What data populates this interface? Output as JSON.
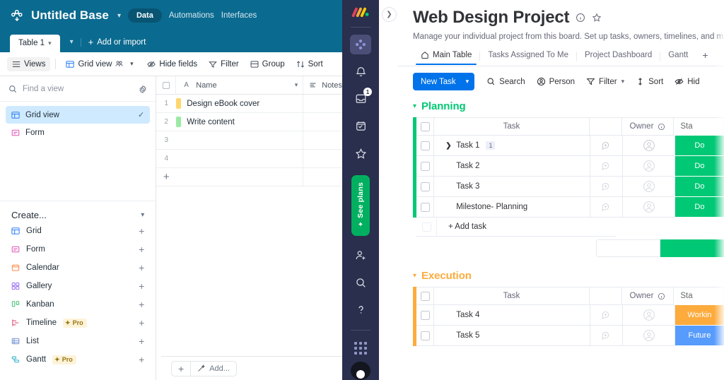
{
  "airtable": {
    "topbar": {
      "logo_icon": "airtable-logo-icon",
      "base_name": "Untitled Base",
      "base_caret_icon": "chevron-down-icon",
      "nav": [
        {
          "label": "Data",
          "active": true
        },
        {
          "label": "Automations",
          "active": false
        },
        {
          "label": "Interfaces",
          "active": false
        }
      ]
    },
    "tabbar": {
      "table_tab": "Table 1",
      "table_tab_caret_icon": "chevron-down-icon",
      "extra_caret_icon": "chevron-down-icon",
      "add_or_import": "Add or import",
      "add_icon": "plus-icon"
    },
    "toolbar": {
      "views_label": "Views",
      "views_icon": "hamburger-icon",
      "grid_view_label": "Grid view",
      "grid_view_icon": "grid-icon",
      "grid_view_collab_icon": "collaborators-icon",
      "grid_view_caret_icon": "chevron-down-icon",
      "hide_fields_label": "Hide fields",
      "hide_fields_icon": "eye-off-icon",
      "filter_label": "Filter",
      "filter_icon": "funnel-icon",
      "group_label": "Group",
      "group_icon": "group-icon",
      "sort_label": "Sort",
      "sort_icon": "sort-icon"
    },
    "sidebar": {
      "search_placeholder": "Find a view",
      "search_icon": "search-icon",
      "settings_icon": "gear-icon",
      "views": [
        {
          "label": "Grid view",
          "icon": "grid-icon",
          "selected": true,
          "check_icon": "check-icon"
        },
        {
          "label": "Form",
          "icon": "form-icon",
          "selected": false
        }
      ],
      "create_label": "Create...",
      "create_caret_icon": "chevron-down-icon",
      "create_items": [
        {
          "label": "Grid",
          "icon": "grid-icon",
          "pro": false,
          "add_icon": "plus-icon"
        },
        {
          "label": "Form",
          "icon": "form-icon",
          "pro": false,
          "add_icon": "plus-icon"
        },
        {
          "label": "Calendar",
          "icon": "calendar-icon",
          "pro": false,
          "add_icon": "plus-icon"
        },
        {
          "label": "Gallery",
          "icon": "gallery-icon",
          "pro": false,
          "add_icon": "plus-icon"
        },
        {
          "label": "Kanban",
          "icon": "kanban-icon",
          "pro": false,
          "add_icon": "plus-icon"
        },
        {
          "label": "Timeline",
          "icon": "timeline-icon",
          "pro": true,
          "pro_label": "Pro",
          "add_icon": "plus-icon"
        },
        {
          "label": "List",
          "icon": "list-icon",
          "pro": false,
          "add_icon": "plus-icon"
        },
        {
          "label": "Gantt",
          "icon": "gantt-icon",
          "pro": true,
          "pro_label": "Pro",
          "add_icon": "plus-icon"
        }
      ]
    },
    "grid": {
      "columns": [
        {
          "label": "Name",
          "icon": "text-field-icon"
        },
        {
          "label": "Notes",
          "icon": "long-text-icon"
        }
      ],
      "name_caret_icon": "chevron-down-icon",
      "header_checkbox_icon": "checkbox-icon",
      "rows": [
        {
          "num": "1",
          "name": "Design eBook cover",
          "swatch": "#ffd66e",
          "notes": ""
        },
        {
          "num": "2",
          "name": "Write content",
          "swatch": "#9beaa4",
          "notes": ""
        },
        {
          "num": "3",
          "name": "",
          "swatch": "",
          "notes": ""
        },
        {
          "num": "4",
          "name": "",
          "swatch": "",
          "notes": ""
        }
      ],
      "add_row_icon": "plus-icon"
    },
    "bottombar": {
      "add_record_icon": "plus-icon",
      "magic_label": "Add...",
      "magic_icon": "magic-wand-icon"
    }
  },
  "monday": {
    "rail": {
      "logo_icon": "monday-logo-icon",
      "items": [
        {
          "name": "workspace-icon",
          "active": true
        },
        {
          "name": "bell-icon",
          "active": false
        },
        {
          "name": "inbox-icon",
          "active": false,
          "badge": "1"
        },
        {
          "name": "my-work-icon",
          "active": false
        },
        {
          "name": "favorites-star-icon",
          "active": false
        }
      ],
      "see_plans_label": "See plans",
      "see_plans_icon": "sparkle-icon",
      "see_plans_color": "#00b060",
      "bottom_items": [
        {
          "name": "invite-member-icon"
        },
        {
          "name": "search-icon"
        },
        {
          "name": "help-question-icon"
        }
      ],
      "apps_grid_icon": "apps-grid-icon",
      "avatar_icon": "user-avatar"
    },
    "expand_icon": "chevron-right-icon",
    "header": {
      "title": "Web Design Project",
      "info_icon": "info-icon",
      "favorite_icon": "star-icon",
      "subtitle": "Manage your individual project from this board. Set up tasks, owners, timelines, and m",
      "tabs": [
        {
          "label": "Main Table",
          "icon": "home-icon",
          "active": true
        },
        {
          "label": "Tasks Assigned To Me",
          "icon": "",
          "active": false
        },
        {
          "label": "Project Dashboard",
          "icon": "",
          "active": false
        },
        {
          "label": "Gantt",
          "icon": "",
          "active": false
        }
      ],
      "add_tab_icon": "plus-icon"
    },
    "toolbar": {
      "new_task_label": "New Task",
      "new_task_caret_icon": "chevron-down-icon",
      "new_task_color": "#0073ea",
      "buttons": [
        {
          "label": "Search",
          "icon": "search-icon",
          "caret": false
        },
        {
          "label": "Person",
          "icon": "person-icon",
          "caret": false
        },
        {
          "label": "Filter",
          "icon": "funnel-icon",
          "caret": true
        },
        {
          "label": "Sort",
          "icon": "sort-icon",
          "caret": false
        },
        {
          "label": "Hid",
          "icon": "eye-off-icon",
          "caret": false
        }
      ]
    },
    "board": {
      "columns": {
        "task": "Task",
        "owner": "Owner",
        "status": "Sta"
      },
      "owner_info_icon": "info-icon",
      "collapse_icon": "chevron-down-icon",
      "groups": [
        {
          "name": "Planning",
          "color": "#00c875",
          "rows": [
            {
              "task": "Task 1",
              "expandable": true,
              "subitem_count": "1",
              "status": "Do",
              "status_color": "#00c875"
            },
            {
              "task": "Task 2",
              "expandable": false,
              "status": "Do",
              "status_color": "#00c875"
            },
            {
              "task": "Task 3",
              "expandable": false,
              "status": "Do",
              "status_color": "#00c875"
            },
            {
              "task": "Milestone- Planning",
              "expandable": false,
              "status": "Do",
              "status_color": "#00c875"
            }
          ],
          "add_task_label": "+ Add task",
          "summary_bar_color": "#00c875"
        },
        {
          "name": "Execution",
          "color": "#fdab3d",
          "rows": [
            {
              "task": "Task 4",
              "expandable": false,
              "status": "Workin",
              "status_color": "#fdab3d"
            },
            {
              "task": "Task 5",
              "expandable": false,
              "status": "Future",
              "status_color": "#579bfc"
            }
          ]
        }
      ]
    }
  }
}
